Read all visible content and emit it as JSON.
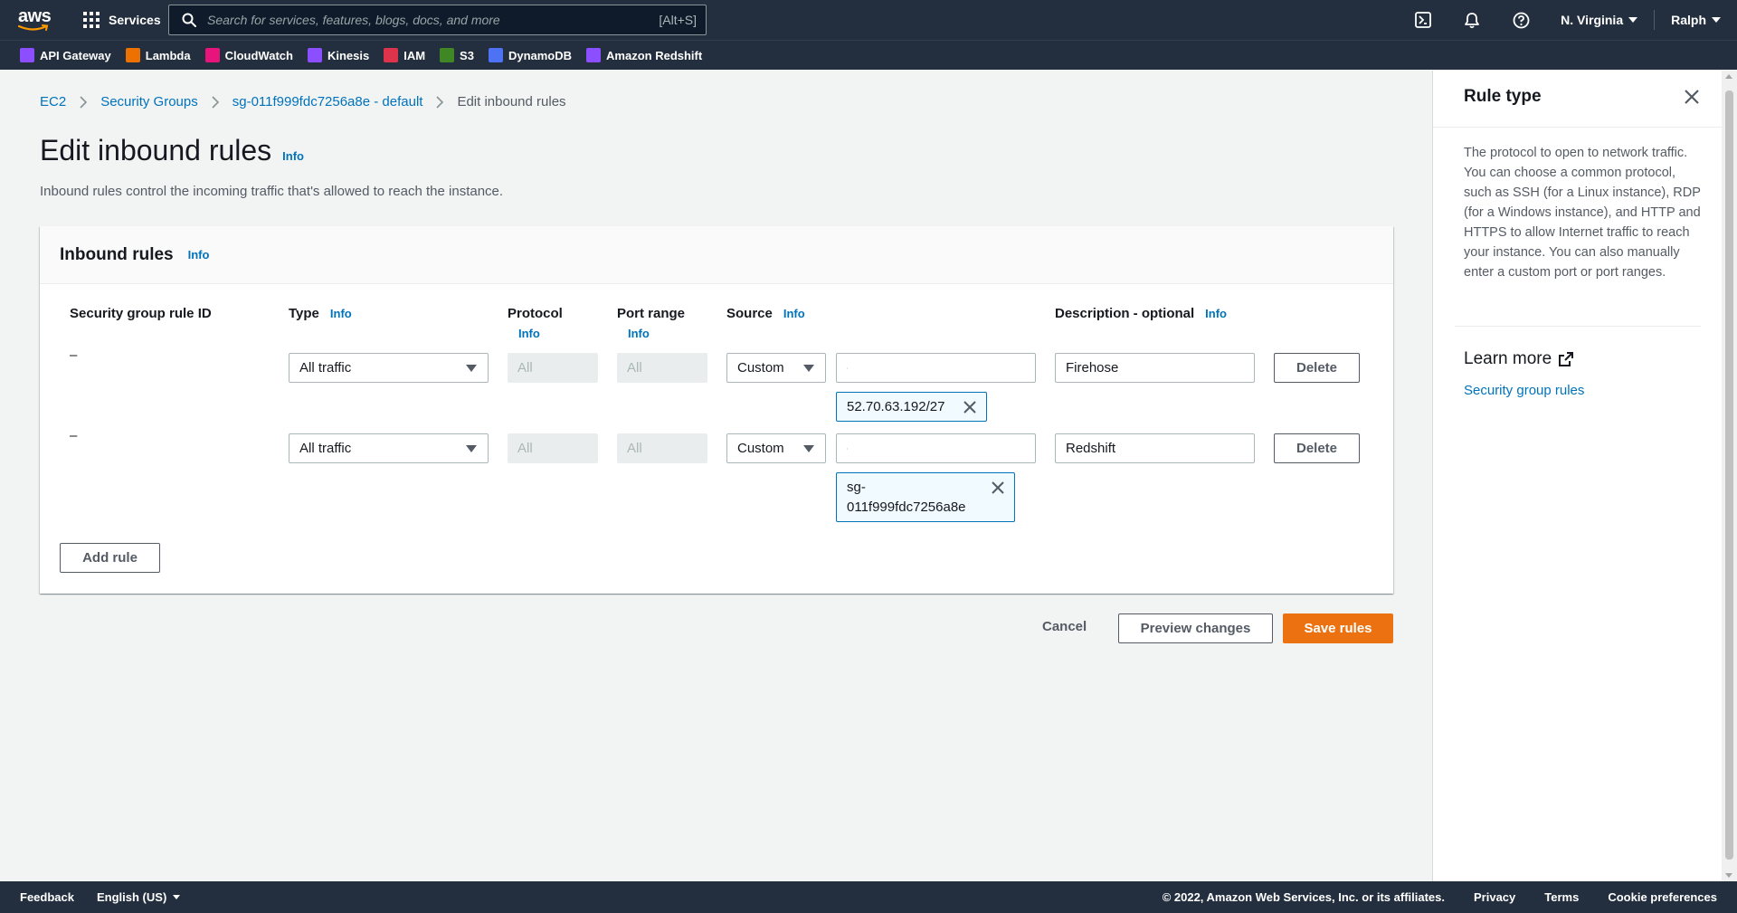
{
  "nav": {
    "logo": "aws",
    "services_label": "Services",
    "search_placeholder": "Search for services, features, blogs, docs, and more",
    "search_shortcut": "[Alt+S]",
    "region": "N. Virginia",
    "user": "Ralph"
  },
  "favorites": [
    {
      "label": "API Gateway",
      "icon": "api-gateway-icon",
      "color": "#8c4fff"
    },
    {
      "label": "Lambda",
      "icon": "lambda-icon",
      "color": "#ed7100"
    },
    {
      "label": "CloudWatch",
      "icon": "cloudwatch-icon",
      "color": "#e7157b"
    },
    {
      "label": "Kinesis",
      "icon": "kinesis-icon",
      "color": "#8c4fff"
    },
    {
      "label": "IAM",
      "icon": "iam-icon",
      "color": "#dd344c"
    },
    {
      "label": "S3",
      "icon": "s3-icon",
      "color": "#3f8624"
    },
    {
      "label": "DynamoDB",
      "icon": "dynamodb-icon",
      "color": "#4d72f3"
    },
    {
      "label": "Amazon Redshift",
      "icon": "redshift-icon",
      "color": "#8c4fff"
    }
  ],
  "breadcrumb": {
    "ec2": "EC2",
    "security_groups": "Security Groups",
    "sg": "sg-011f999fdc7256a8e - default",
    "current": "Edit inbound rules"
  },
  "page": {
    "title": "Edit inbound rules",
    "info": "Info",
    "description": "Inbound rules control the incoming traffic that's allowed to reach the instance."
  },
  "panel": {
    "title": "Inbound rules",
    "info": "Info",
    "columns": {
      "rule_id": "Security group rule ID",
      "type": "Type",
      "protocol": "Protocol",
      "port_range": "Port range",
      "source": "Source",
      "description": "Description - optional"
    },
    "rows": [
      {
        "rule_id": "–",
        "type": "All traffic",
        "protocol": "All",
        "port_range": "All",
        "source_type": "Custom",
        "source_search": "",
        "token": "52.70.63.192/27",
        "description": "Firehose",
        "delete": "Delete"
      },
      {
        "rule_id": "–",
        "type": "All traffic",
        "protocol": "All",
        "port_range": "All",
        "source_type": "Custom",
        "source_search": "",
        "token_line1": "sg-",
        "token_line2": "011f999fdc7256a8e",
        "description": "Redshift",
        "delete": "Delete"
      }
    ],
    "add_rule": "Add rule"
  },
  "actions": {
    "cancel": "Cancel",
    "preview": "Preview changes",
    "save": "Save rules"
  },
  "help": {
    "title": "Rule type",
    "body": "The protocol to open to network traffic. You can choose a common protocol, such as SSH (for a Linux instance), RDP (for a Windows instance), and HTTP and HTTPS to allow Internet traffic to reach your instance. You can also manually enter a custom port or port ranges.",
    "learn_more": "Learn more",
    "link": "Security group rules"
  },
  "footer": {
    "feedback": "Feedback",
    "language": "English (US)",
    "copyright": "© 2022, Amazon Web Services, Inc. or its affiliates.",
    "privacy": "Privacy",
    "terms": "Terms",
    "cookies": "Cookie preferences"
  },
  "colors": {
    "nav_bg": "#232f3e",
    "link": "#0073bb",
    "primary": "#ec7211",
    "token_border": "#0073bb"
  }
}
